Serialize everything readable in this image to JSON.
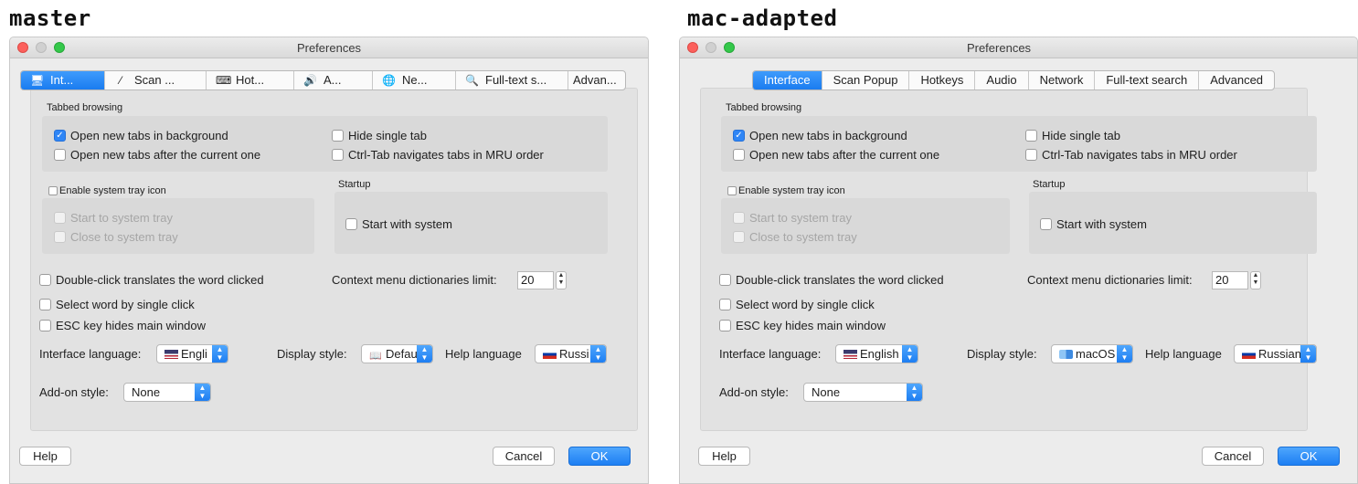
{
  "captions": {
    "left": "master",
    "right": "mac-adapted"
  },
  "window": {
    "title": "Preferences"
  },
  "tabs_master": [
    {
      "label": "Int...",
      "icon": "monitor-icon",
      "glyph": "🖥"
    },
    {
      "label": "Scan ...",
      "icon": "magic-wand-icon",
      "glyph": "⁄"
    },
    {
      "label": "Hot...",
      "icon": "keyboard-icon",
      "glyph": "⌨"
    },
    {
      "label": "A...",
      "icon": "speaker-icon",
      "glyph": "🔊"
    },
    {
      "label": "Ne...",
      "icon": "globe-icon",
      "glyph": "🌐"
    },
    {
      "label": "Full-text s...",
      "icon": "magnifier-icon",
      "glyph": "🔍"
    },
    {
      "label": "Advan..."
    }
  ],
  "tabs_mac": [
    "Interface",
    "Scan Popup",
    "Hotkeys",
    "Audio",
    "Network",
    "Full-text search",
    "Advanced"
  ],
  "tabbed": {
    "title": "Tabbed browsing",
    "open_bg": "Open new tabs in background",
    "open_after": "Open new tabs after the current one",
    "hide_single": "Hide single tab",
    "ctrl_tab": "Ctrl-Tab navigates tabs in MRU order"
  },
  "tray": {
    "title": "Enable system tray icon",
    "start_tray": "Start to system tray",
    "close_tray": "Close to system tray"
  },
  "startup": {
    "title": "Startup",
    "start_system": "Start with system"
  },
  "options": {
    "double_click": "Double-click translates the word clicked",
    "single_click": "Select word by single click",
    "esc_hides": "ESC key hides main window",
    "ctx_label": "Context menu dictionaries limit:",
    "ctx_value": "20"
  },
  "combos": {
    "interface_language": "Interface language:",
    "display_style": "Display style:",
    "help_language": "Help language",
    "addon_style": "Add-on style:",
    "master": {
      "iface": "Engli",
      "display": "Defau",
      "help": "Russi",
      "addon": "None"
    },
    "mac": {
      "iface": "English",
      "display": "macOS",
      "help": "Russian",
      "addon": "None"
    }
  },
  "buttons": {
    "help": "Help",
    "cancel": "Cancel",
    "ok": "OK"
  },
  "colors": {
    "accent": "#2f86f6",
    "window_bg": "#ececec",
    "group_bg": "#d9d9d9"
  }
}
